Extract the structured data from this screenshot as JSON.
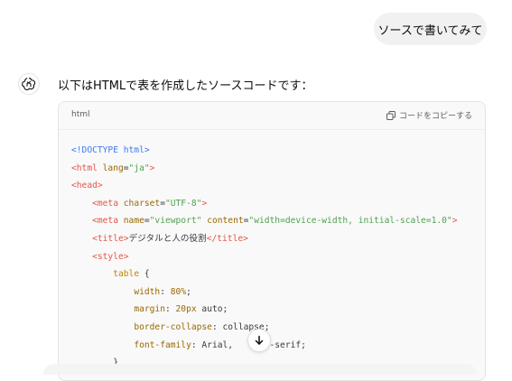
{
  "user_message": "ソースで書いてみて",
  "assistant": {
    "intro": "以下はHTMLで表を作成したソースコードです："
  },
  "code_block": {
    "language": "html",
    "copy_label": "コードをコピーする",
    "lines": [
      [
        {
          "t": "<!DOCTYPE html>",
          "c": "t-doctype"
        }
      ],
      [
        {
          "t": "<html ",
          "c": "t-tag"
        },
        {
          "t": "lang",
          "c": "t-attr"
        },
        {
          "t": "=",
          "c": "t-plain"
        },
        {
          "t": "\"ja\"",
          "c": "t-str"
        },
        {
          "t": ">",
          "c": "t-tag"
        }
      ],
      [
        {
          "t": "<head>",
          "c": "t-tag"
        }
      ],
      [
        {
          "t": "    ",
          "c": "t-plain"
        },
        {
          "t": "<meta ",
          "c": "t-tag"
        },
        {
          "t": "charset",
          "c": "t-attr"
        },
        {
          "t": "=",
          "c": "t-plain"
        },
        {
          "t": "\"UTF-8\"",
          "c": "t-str"
        },
        {
          "t": ">",
          "c": "t-tag"
        }
      ],
      [
        {
          "t": "    ",
          "c": "t-plain"
        },
        {
          "t": "<meta ",
          "c": "t-tag"
        },
        {
          "t": "name",
          "c": "t-attr"
        },
        {
          "t": "=",
          "c": "t-plain"
        },
        {
          "t": "\"viewport\"",
          "c": "t-str"
        },
        {
          "t": " ",
          "c": "t-plain"
        },
        {
          "t": "content",
          "c": "t-attr"
        },
        {
          "t": "=",
          "c": "t-plain"
        },
        {
          "t": "\"width=device-width, initial-scale=1.0\"",
          "c": "t-str"
        },
        {
          "t": ">",
          "c": "t-tag"
        }
      ],
      [
        {
          "t": "    ",
          "c": "t-plain"
        },
        {
          "t": "<title>",
          "c": "t-tag"
        },
        {
          "t": "デジタルと人の役割",
          "c": "t-plain"
        },
        {
          "t": "</title>",
          "c": "t-tag"
        }
      ],
      [
        {
          "t": "    ",
          "c": "t-plain"
        },
        {
          "t": "<style>",
          "c": "t-tag"
        }
      ],
      [
        {
          "t": "        ",
          "c": "t-plain"
        },
        {
          "t": "table",
          "c": "t-sel"
        },
        {
          "t": " {",
          "c": "t-plain"
        }
      ],
      [
        {
          "t": "            ",
          "c": "t-plain"
        },
        {
          "t": "width",
          "c": "t-prop"
        },
        {
          "t": ": ",
          "c": "t-plain"
        },
        {
          "t": "80%",
          "c": "t-num"
        },
        {
          "t": ";",
          "c": "t-plain"
        }
      ],
      [
        {
          "t": "            ",
          "c": "t-plain"
        },
        {
          "t": "margin",
          "c": "t-prop"
        },
        {
          "t": ": ",
          "c": "t-plain"
        },
        {
          "t": "20px",
          "c": "t-num"
        },
        {
          "t": " auto;",
          "c": "t-plain"
        }
      ],
      [
        {
          "t": "            ",
          "c": "t-plain"
        },
        {
          "t": "border-collapse",
          "c": "t-prop"
        },
        {
          "t": ": collapse;",
          "c": "t-plain"
        }
      ],
      [
        {
          "t": "            ",
          "c": "t-plain"
        },
        {
          "t": "font-family",
          "c": "t-prop"
        },
        {
          "t": ": Arial,      s-serif;",
          "c": "t-plain"
        }
      ],
      [
        {
          "t": "        }",
          "c": "t-plain"
        }
      ]
    ]
  },
  "icons": {
    "assistant_avatar": "openai-logo-icon",
    "copy": "copy-icon",
    "scroll_down": "arrow-down-icon"
  }
}
